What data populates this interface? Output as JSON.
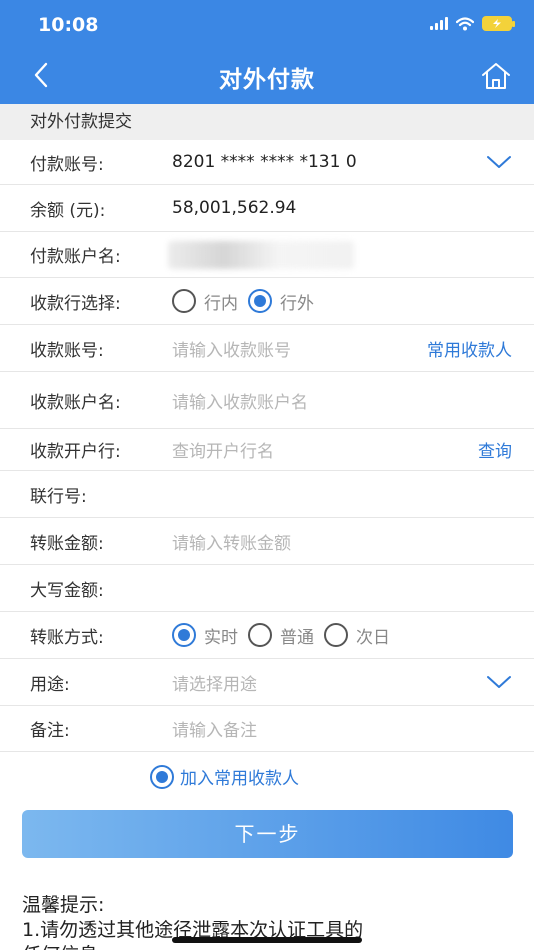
{
  "status_bar": {
    "time": "10:08"
  },
  "header": {
    "title": "对外付款",
    "back_icon": "chevron-left-icon",
    "home_icon": "home-icon"
  },
  "section": {
    "title": "对外付款提交"
  },
  "form": {
    "payer_account": {
      "label": "付款账号:",
      "value": "8201 **** **** *131 0"
    },
    "balance": {
      "label": "余额 (元):",
      "value": "58,001,562.94"
    },
    "payer_name": {
      "label": "付款账户名:"
    },
    "bank_choice": {
      "label": "收款行选择:",
      "options": [
        "行内",
        "行外"
      ],
      "selected": "行外"
    },
    "payee_account": {
      "label": "收款账号:",
      "placeholder": "请输入收款账号",
      "action": "常用收款人"
    },
    "payee_name": {
      "label": "收款账户名:",
      "placeholder": "请输入收款账户名"
    },
    "payee_bank": {
      "label": "收款开户行:",
      "placeholder": "查询开户行名",
      "action": "查询"
    },
    "bank_code": {
      "label": "联行号:"
    },
    "amount": {
      "label": "转账金额:",
      "placeholder": "请输入转账金额"
    },
    "amount_upper": {
      "label": "大写金额:"
    },
    "transfer_mode": {
      "label": "转账方式:",
      "options": [
        "实时",
        "普通",
        "次日"
      ],
      "selected": "实时"
    },
    "purpose": {
      "label": "用途:",
      "placeholder": "请选择用途"
    },
    "remark": {
      "label": "备注:",
      "placeholder": "请输入备注"
    }
  },
  "add_payee": {
    "label": "加入常用收款人",
    "checked": true
  },
  "next_button": {
    "label": "下一步"
  },
  "tips": {
    "title": "温馨提示:",
    "line1": "1.请勿透过其他途径泄露本次认证工具的",
    "line2": "任何信息;"
  },
  "colors": {
    "header_bg": "#3b87e4",
    "accent": "#2f7ad8",
    "section_bg": "#efefef"
  }
}
